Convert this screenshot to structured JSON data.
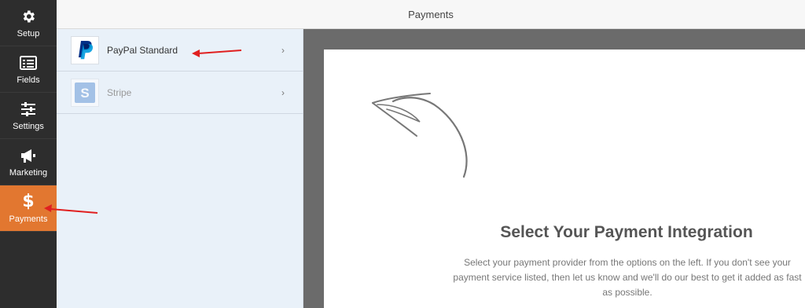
{
  "sidebar": {
    "items": [
      {
        "label": "Setup",
        "icon": "gear-icon"
      },
      {
        "label": "Fields",
        "icon": "fields-list-icon"
      },
      {
        "label": "Settings",
        "icon": "sliders-icon"
      },
      {
        "label": "Marketing",
        "icon": "megaphone-icon"
      },
      {
        "label": "Payments",
        "icon": "dollar-icon",
        "active": true
      }
    ]
  },
  "header": {
    "title": "Payments"
  },
  "providers": [
    {
      "name": "PayPal Standard",
      "logo": "paypal-logo-icon",
      "enabled": true
    },
    {
      "name": "Stripe",
      "logo": "stripe-logo-icon",
      "enabled": false
    }
  ],
  "main": {
    "heading": "Select Your Payment Integration",
    "description": "Select your payment provider from the options on the left. If you don't see your payment service listed, then let us know and we'll do our best to get it added as fast as possible."
  },
  "colors": {
    "sidebar_bg": "#2d2d2d",
    "active_accent": "#e27730",
    "provider_panel_bg": "#e9f1f9",
    "content_bg": "#6b6b6b",
    "annotation_arrow": "#e02020"
  }
}
